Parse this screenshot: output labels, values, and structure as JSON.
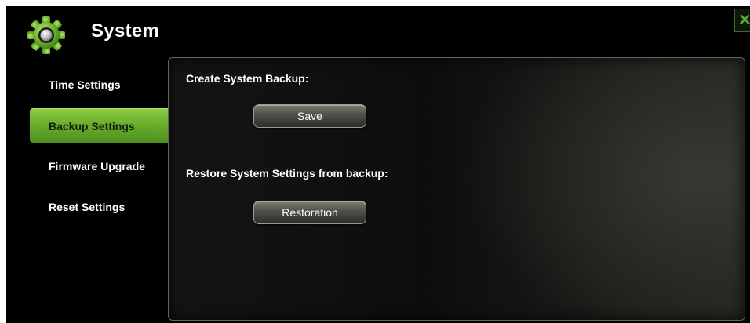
{
  "header": {
    "title": "System",
    "icon": "gear-icon",
    "close_icon": "close-icon",
    "close_glyph": "✕"
  },
  "sidebar": {
    "items": [
      {
        "label": "Time Settings",
        "active": false
      },
      {
        "label": "Backup Settings",
        "active": true
      },
      {
        "label": "Firmware Upgrade",
        "active": false
      },
      {
        "label": "Reset Settings",
        "active": false
      }
    ]
  },
  "panel": {
    "backup_label": "Create System Backup:",
    "save_label": "Save",
    "restore_label": "Restore System Settings from backup:",
    "restoration_label": "Restoration"
  },
  "colors": {
    "accent_green": "#6aae2c",
    "background": "#000000",
    "close_icon": "#5ea53b"
  }
}
